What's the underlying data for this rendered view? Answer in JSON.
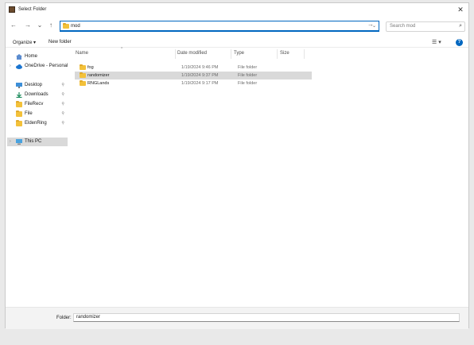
{
  "window": {
    "title": "Select Folder",
    "close_glyph": "✕"
  },
  "nav": {
    "back": "←",
    "forward": "→",
    "recent": "⌄",
    "up": "↑",
    "address": "mod",
    "address_chevron": "⌄",
    "go": "→",
    "search_placeholder": "Search mod",
    "search_icon": "⌕"
  },
  "commands": {
    "organize": "Organize ▾",
    "new_folder": "New folder",
    "view": "☰ ▾",
    "help": "?"
  },
  "sidebar": {
    "items": [
      {
        "label": "Home",
        "icon": "home-icon"
      },
      {
        "label": "OneDrive - Personal",
        "icon": "cloud-icon",
        "expand": "›"
      },
      {
        "label": "Desktop",
        "icon": "desktop-icon",
        "pin": "📌"
      },
      {
        "label": "Downloads",
        "icon": "download-icon",
        "pin": "📌"
      },
      {
        "label": "FileRecv",
        "icon": "folder-icon",
        "pin": "📌"
      },
      {
        "label": "File",
        "icon": "folder-icon",
        "pin": "📌"
      },
      {
        "label": "EldenRing",
        "icon": "folder-icon",
        "pin": "📌"
      },
      {
        "label": "This PC",
        "icon": "computer-icon",
        "expand": "›"
      }
    ]
  },
  "columns": {
    "name": "Name",
    "date": "Date modified",
    "type": "Type",
    "size": "Size",
    "sort": "^"
  },
  "files": [
    {
      "name": "fog",
      "date": "1/19/2024 9:46 PM",
      "type": "File folder"
    },
    {
      "name": "randomizer",
      "date": "1/19/2024 9:37 PM",
      "type": "File folder"
    },
    {
      "name": "RNGLands",
      "date": "1/19/2024 9:17 PM",
      "type": "File folder"
    }
  ],
  "footer": {
    "folder_label": "Folder:",
    "folder_value": "randomizer"
  },
  "colors": {
    "accent": "#0067c0",
    "folder": "#f3c13a",
    "selection": "#d9d9d9"
  }
}
